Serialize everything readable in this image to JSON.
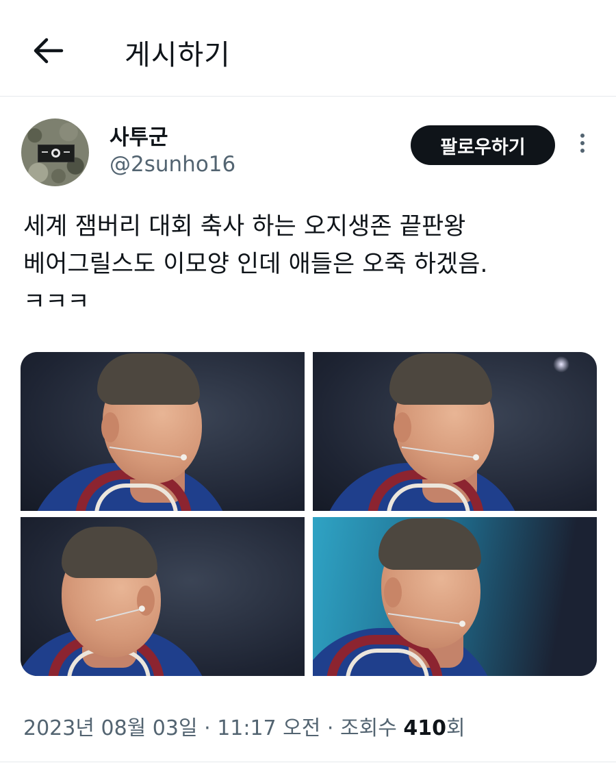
{
  "header": {
    "title": "게시하기",
    "back_icon": "arrow-left-icon"
  },
  "author": {
    "display_name": "사투군",
    "handle": "@2sunho16",
    "avatar_icon": "camouflage-patch-avatar"
  },
  "follow_button": {
    "label": "팔로우하기"
  },
  "more_icon": "more-vertical-icon",
  "post": {
    "lines": [
      "세계 잼버리 대회 축사 하는 오지생존 끝판왕",
      "베어그릴스도 이모양 인데 애들은 오죽 하겠음.",
      "ㅋㅋㅋ"
    ]
  },
  "media": {
    "photo_count": 4
  },
  "meta": {
    "date": "2023년 08월 03일",
    "separator": " · ",
    "time": "11:17 오전",
    "views_label": "조회수 ",
    "views_count": "410",
    "views_unit": "회"
  },
  "colors": {
    "text": "#0f1419",
    "secondary": "#536471",
    "button_bg": "#0f1419",
    "divider": "#e6e9ec"
  }
}
